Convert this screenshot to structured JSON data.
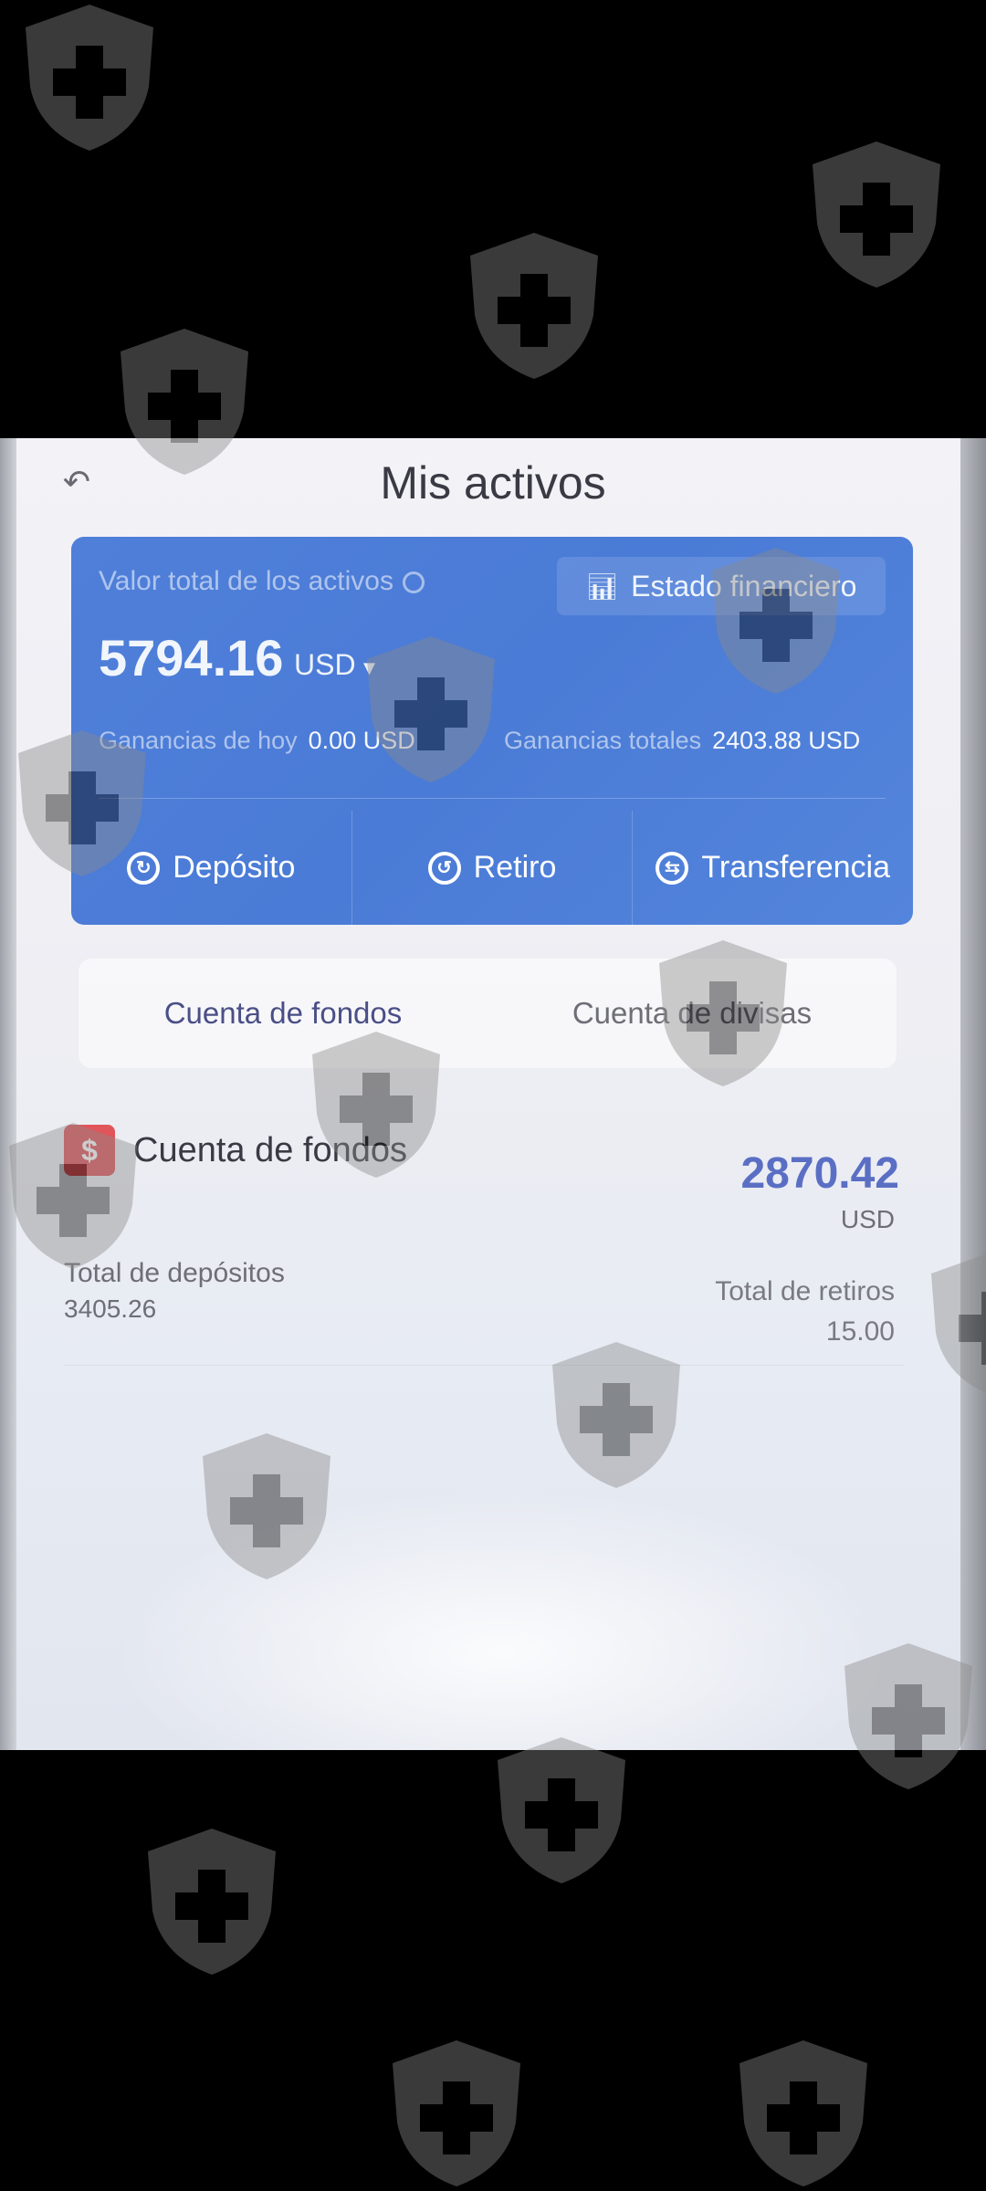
{
  "header": {
    "title": "Mis activos",
    "back_icon": "back-arrow-icon"
  },
  "assets_card": {
    "total_label": "Valor total de los activos",
    "total_value": "5794.16",
    "currency": "USD",
    "financial_statement_label": "Estado financiero",
    "today_label": "Ganancias de hoy",
    "today_value": "0.00 USD",
    "total_earnings_label": "Ganancias totales",
    "total_earnings_value": "2403.88 USD",
    "accent": "#4f7fd9",
    "actions": [
      {
        "label": "Depósito",
        "icon": "deposit-icon"
      },
      {
        "label": "Retiro",
        "icon": "withdraw-icon"
      },
      {
        "label": "Transferencia",
        "icon": "transfer-icon"
      }
    ]
  },
  "tabs": [
    {
      "label": "Cuenta de fondos",
      "active": true
    },
    {
      "label": "Cuenta de divisas",
      "active": false
    }
  ],
  "fund_account": {
    "title": "Cuenta de fondos",
    "balance": "2870.42",
    "currency": "USD",
    "deposits_label": "Total de depósitos",
    "deposits_value": "3405.26",
    "withdrawals_label": "Total de retiros",
    "withdrawals_value": "15.00"
  }
}
